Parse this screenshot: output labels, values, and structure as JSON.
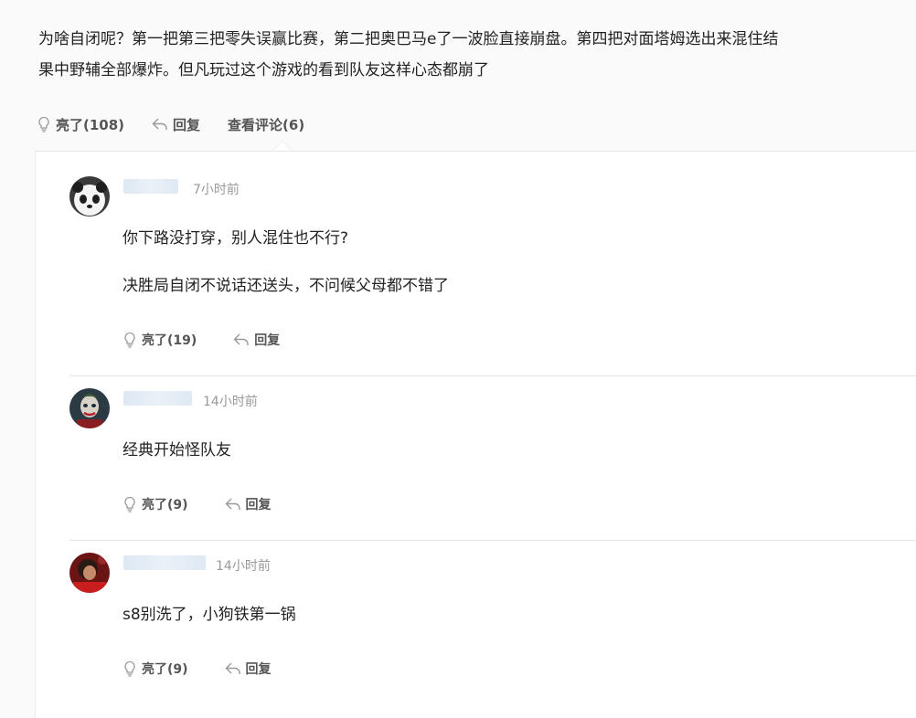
{
  "post": {
    "text_line1": "为啥自闭呢？第一把第三把零失误赢比赛，第二把奥巴马e了一波脸直接崩盘。第四把对面塔姆选出来混住结",
    "text_line2": "果中野辅全部爆炸。但凡玩过这个游戏的看到队友这样心态都崩了",
    "like_label": "亮了(108)",
    "reply_label": "回复",
    "view_comments_label": "查看评论(6)"
  },
  "comments": [
    {
      "avatar_icon": "panda-avatar",
      "time": "7小时前",
      "lines": [
        "你下路没打穿，别人混住也不行?",
        "决胜局自闭不说话还送头，不问候父母都不错了"
      ],
      "like_label": "亮了(19)",
      "reply_label": "回复"
    },
    {
      "avatar_icon": "joker-avatar",
      "time": "14小时前",
      "lines": [
        "经典开始怪队友"
      ],
      "like_label": "亮了(9)",
      "reply_label": "回复"
    },
    {
      "avatar_icon": "red-photo-avatar",
      "time": "14小时前",
      "lines": [
        "s8别洗了，小狗铁第一锅"
      ],
      "like_label": "亮了(9)",
      "reply_label": "回复"
    }
  ],
  "colors": {
    "text": "#222222",
    "muted": "#999999",
    "action": "#555555",
    "divider": "#e6e6e6"
  }
}
